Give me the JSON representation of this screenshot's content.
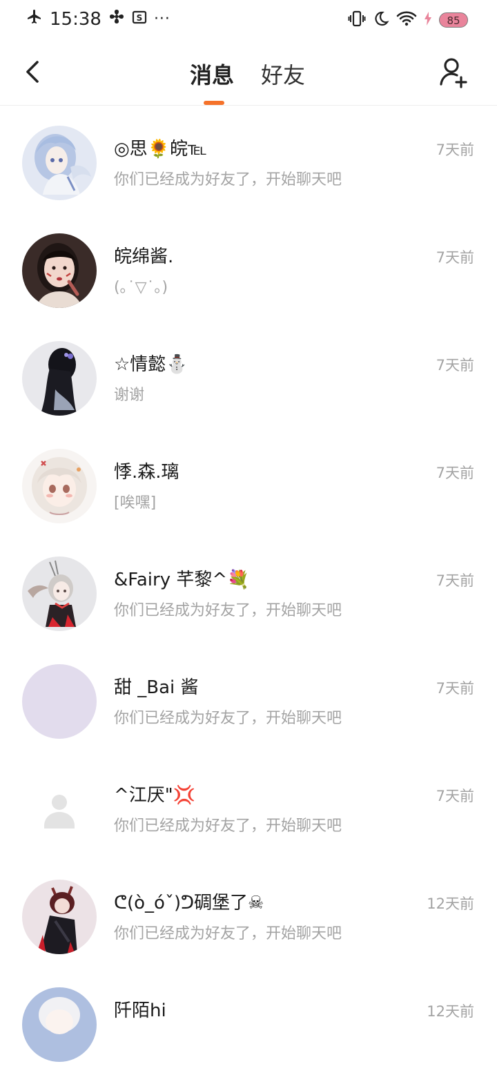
{
  "status_bar": {
    "time": "15:38",
    "more": "···",
    "battery": "85"
  },
  "header": {
    "tabs": [
      {
        "label": "消息",
        "active": true
      },
      {
        "label": "好友",
        "active": false
      }
    ],
    "accent_color": "#f5722a"
  },
  "conversations": [
    {
      "name": "◎思🌻皖℡",
      "preview": "你们已经成为好友了，开始聊天吧",
      "time": "7天前",
      "avatar": "anime-blue-hair"
    },
    {
      "name": " 皖绵酱.",
      "preview": "(｡˙▽˙｡)",
      "time": "7天前",
      "avatar": "photo-girl"
    },
    {
      "name": "☆情懿⛄",
      "preview": "谢谢",
      "time": "7天前",
      "avatar": "dark-figure"
    },
    {
      "name": "悸.森.璃",
      "preview": "[唉嘿]",
      "time": "7天前",
      "avatar": "anime-white-hair"
    },
    {
      "name": "&Fairy 芊黎^💐",
      "preview": "你们已经成为好友了，开始聊天吧",
      "time": "7天前",
      "avatar": "anime-fox-ears"
    },
    {
      "name": "甜 _Bai 酱",
      "preview": "你们已经成为好友了，开始聊天吧",
      "time": "7天前",
      "avatar": "plain-lavender"
    },
    {
      "name": "^江厌\"💢",
      "preview": "你们已经成为好友了，开始聊天吧",
      "time": "7天前",
      "avatar": "default-person"
    },
    {
      "name": "ᕦ(ò_óˇ)ᕤ碉堡了☠",
      "preview": "你们已经成为好友了，开始聊天吧",
      "time": "12天前",
      "avatar": "anime-red-hair"
    },
    {
      "name": "阡陌hi",
      "preview": "",
      "time": "12天前",
      "avatar": "partial"
    }
  ]
}
